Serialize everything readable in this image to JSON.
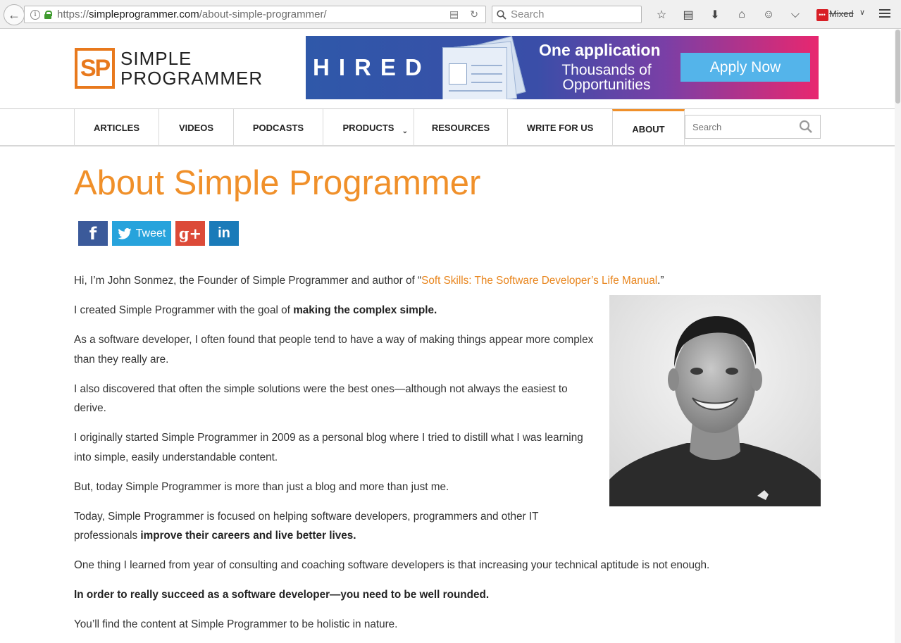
{
  "browser": {
    "url_prefix": "https://",
    "url_host": "simpleprogrammer.com",
    "url_path": "/about-simple-programmer/",
    "search_placeholder": "Search",
    "mixed_label": "Mixed"
  },
  "site": {
    "logo_mark": "SP",
    "logo_line1": "SIMPLE",
    "logo_line2": "PROGRAMMER"
  },
  "banner": {
    "brand": "HIRED",
    "headline": "One application",
    "subline": "Thousands of Opportunities",
    "cta": "Apply Now"
  },
  "nav": {
    "items": [
      {
        "label": "ARTICLES"
      },
      {
        "label": "VIDEOS"
      },
      {
        "label": "PODCASTS"
      },
      {
        "label": "PRODUCTS"
      },
      {
        "label": "RESOURCES"
      },
      {
        "label": "WRITE FOR US"
      },
      {
        "label": "ABOUT"
      }
    ],
    "search_placeholder": "Search"
  },
  "page": {
    "title": "About Simple Programmer",
    "share": {
      "facebook": "f",
      "tweet": "Tweet",
      "google": "g+",
      "linkedin": "in"
    },
    "p1_pre": "Hi, I’m John Sonmez, the Founder of Simple Programmer and author of “",
    "p1_link": "Soft Skills: The Software Developer’s Life Manual",
    "p1_post": ".”",
    "p2_pre": "I created Simple Programmer with the goal of ",
    "p2_bold": "making the complex simple.",
    "p3": "As a software developer, I often found that people tend to have a way of making things appear more complex than they really are.",
    "p4": "I also discovered that often the simple solutions were the best ones—although not always the easiest to derive.",
    "p5": "I originally started Simple Programmer in 2009 as a personal blog where I tried to distill what I was learning into simple, easily understandable content.",
    "p6": "But, today Simple Programmer is more than just a blog and more than just me.",
    "p7_pre": "Today, Simple Programmer is focused on helping software developers, programmers and other IT professionals ",
    "p7_bold": "improve their careers and live better lives.",
    "p8": "One thing I learned from year of consulting and coaching software developers is that increasing your technical aptitude is not enough.",
    "p9_bold": "In order to really succeed as a software developer—you need to be well rounded.",
    "p10": "You’ll find the content at Simple Programmer to be holistic in nature."
  },
  "colors": {
    "accent": "#f0902a",
    "link": "#e8851d",
    "facebook": "#3b5a9a",
    "twitter": "#27a3dc",
    "google": "#dc4a38",
    "linkedin": "#1a7bb9"
  }
}
